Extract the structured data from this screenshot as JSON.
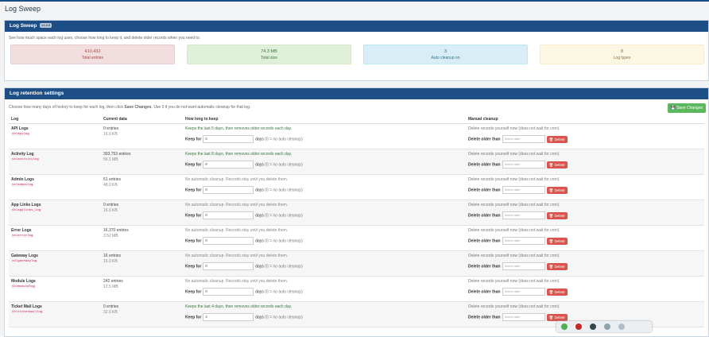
{
  "page_title": "Log Sweep",
  "summary": {
    "title": "Log Sweep",
    "version": "v1.0.0",
    "description": "See how much space each log uses, choose how long to keep it, and delete older records when you need to.",
    "stats": [
      {
        "value": "410,432",
        "label": "Total entries",
        "color": "#f2dede"
      },
      {
        "value": "74.3 MB",
        "label": "Total size",
        "color": "#dff0d8"
      },
      {
        "value": "3",
        "label": "Auto cleanup on",
        "color": "#d9edf7"
      },
      {
        "value": "8",
        "label": "Log types",
        "color": "#fcf8e3"
      }
    ]
  },
  "retention": {
    "title": "Log retention settings",
    "intro_pre": "Choose how many days of history to keep for each log, then click ",
    "intro_bold": "Save Changes",
    "intro_post": ". Use 0 if you do not want automatic cleanup for that log.",
    "save_label": "Save Changes",
    "columns": [
      "Log",
      "Current data",
      "How long to keep",
      "Manual cleanup"
    ],
    "keep_label": "Keep for",
    "days_label": "days",
    "days_hint": "(0 = no auto cleanup)",
    "manual_text": "Delete records yourself now (does not wait for cron)",
    "delete_older_label": "Delete older than",
    "date_placeholder": "Select date",
    "delete_label": "Delete",
    "rows": [
      {
        "name": "API Logs",
        "table": "tblapilog",
        "entries": "0 entries",
        "size": "16.0 KB",
        "status": "Keeps the last 5 days, then removes older records each day.",
        "days": "5",
        "auto": true
      },
      {
        "name": "Activity Log",
        "table": "tblactivitylog",
        "entries": "393,753 entries",
        "size": "56.1 MB",
        "status": "Keeps the last 8 days, then removes older records each day.",
        "days": "8",
        "auto": true
      },
      {
        "name": "Admin Logs",
        "table": "tbladminlog",
        "entries": "51 entries",
        "size": "48.0 KB",
        "status": "No automatic cleanup. Records stay until you delete them.",
        "days": "0",
        "auto": false
      },
      {
        "name": "App Links Logs",
        "table": "tblapplinks_log",
        "entries": "0 entries",
        "size": "16.0 KB",
        "status": "No automatic cleanup. Records stay until you delete them.",
        "days": "0",
        "auto": false
      },
      {
        "name": "Error Logs",
        "table": "tblerrorlog",
        "entries": "16,370 entries",
        "size": "3.52 MB",
        "status": "No automatic cleanup. Records stay until you delete them.",
        "days": "0",
        "auto": false
      },
      {
        "name": "Gateway Logs",
        "table": "tblgatewaylog",
        "entries": "16 entries",
        "size": "16.0 KB",
        "status": "No automatic cleanup. Records stay until you delete them.",
        "days": "0",
        "auto": false
      },
      {
        "name": "Module Logs",
        "table": "tblmodulelog",
        "entries": "242 entries",
        "size": "12.5 MB",
        "status": "No automatic cleanup. Records stay until you delete them.",
        "days": "0",
        "auto": false
      },
      {
        "name": "Ticket Mail Logs",
        "table": "tblticketmaillog",
        "entries": "0 entries",
        "size": "32.0 KB",
        "status": "Keeps the last 4 days, then removes older records each day.",
        "days": "4",
        "auto": true
      }
    ]
  }
}
